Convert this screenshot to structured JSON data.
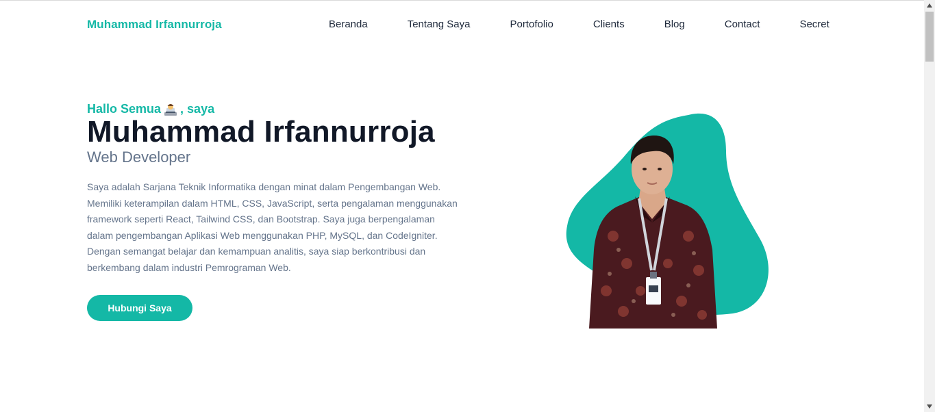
{
  "header": {
    "brand": "Muhammad Irfannurroja",
    "nav": [
      {
        "label": "Beranda"
      },
      {
        "label": "Tentang Saya"
      },
      {
        "label": "Portofolio"
      },
      {
        "label": "Clients"
      },
      {
        "label": "Blog"
      },
      {
        "label": "Contact"
      },
      {
        "label": "Secret"
      }
    ]
  },
  "hero": {
    "greeting_prefix": "Hallo Semua",
    "greeting_suffix": ", saya",
    "greeting_icon": "technologist-emoji-icon",
    "name": "Muhammad Irfannurroja",
    "role": "Web Developer",
    "description": "Saya adalah Sarjana Teknik Informatika dengan minat dalam Pengembangan Web. Memiliki keterampilan dalam HTML, CSS, JavaScript, serta pengalaman menggunakan framework seperti React, Tailwind CSS, dan Bootstrap. Saya juga berpengalaman dalam pengembangan Aplikasi Web menggunakan PHP, MySQL, dan CodeIgniter. Dengan semangat belajar dan kemampuan analitis, saya siap berkontribusi dan berkembang dalam industri Pemrograman Web.",
    "cta_label": "Hubungi Saya"
  },
  "colors": {
    "accent": "#14b8a6",
    "heading": "#111827",
    "muted": "#64748b"
  }
}
